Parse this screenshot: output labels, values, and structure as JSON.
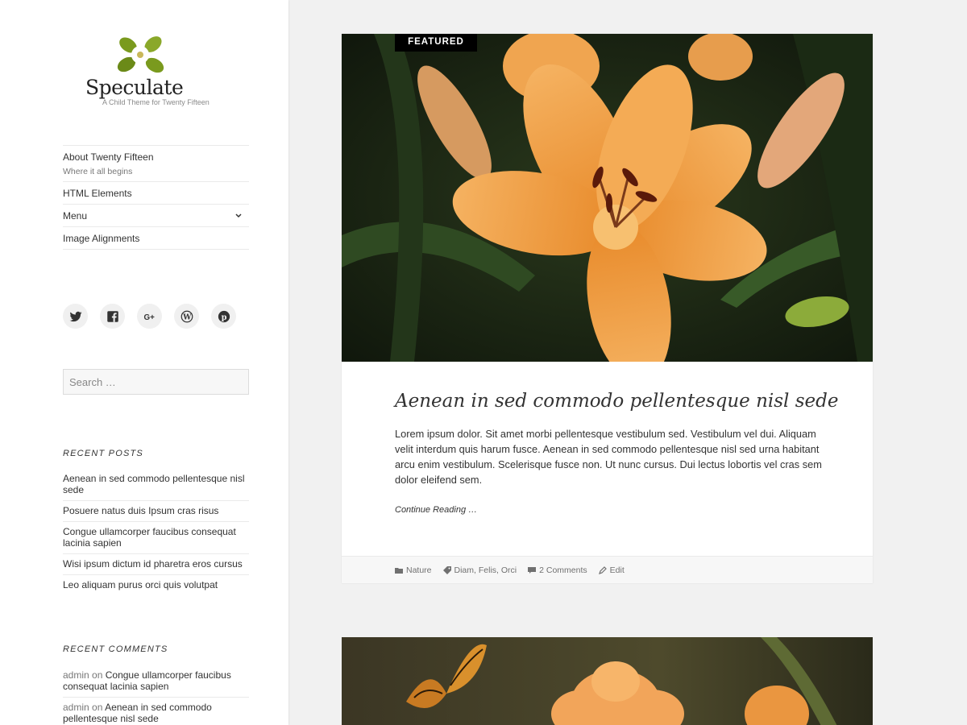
{
  "site": {
    "name": "Speculate",
    "tagline": "A Child Theme for Twenty Fifteen"
  },
  "nav": {
    "items": [
      {
        "label": "About Twenty Fifteen",
        "desc": "Where it all begins"
      },
      {
        "label": "HTML Elements"
      },
      {
        "label": "Menu"
      },
      {
        "label": "Image Alignments"
      }
    ]
  },
  "social": [
    "twitter-icon",
    "facebook-icon",
    "google-plus-icon",
    "wordpress-icon",
    "pinterest-icon"
  ],
  "search": {
    "placeholder": "Search …"
  },
  "recent_posts": {
    "title": "RECENT POSTS",
    "items": [
      "Aenean in sed commodo pellentesque nisl sede",
      "Posuere natus duis Ipsum cras risus",
      "Congue ullamcorper faucibus consequat lacinia sapien",
      "Wisi ipsum dictum id pharetra eros cursus",
      "Leo aliquam purus orci quis volutpat"
    ]
  },
  "recent_comments": {
    "title": "RECENT COMMENTS",
    "items": [
      {
        "author": "admin",
        "on": "on",
        "post": "Congue ullamcorper faucibus consequat lacinia sapien"
      },
      {
        "author": "admin",
        "on": "on",
        "post": "Aenean in sed commodo pellentesque nisl sede"
      }
    ]
  },
  "post": {
    "badge": "FEATURED",
    "title": "Aenean in sed commodo pellentesque nisl sede",
    "excerpt": "Lorem ipsum dolor. Sit amet morbi pellentesque vestibulum sed. Vestibulum vel dui. Aliquam velit interdum quis harum fusce. Aenean in sed commodo pellentesque nisl sed urna habitant arcu enim vestibulum. Scelerisque fusce non. Ut nunc cursus. Dui lectus lobortis vel cras sem dolor eleifend sem.",
    "read_more": "Continue Reading …",
    "meta": {
      "category": "Nature",
      "tags": "Diam, Felis, Orci",
      "comments": "2 Comments",
      "edit": "Edit"
    }
  },
  "colors": {
    "accent": "#000000",
    "sidebar_bg": "#ffffff",
    "page_bg": "#f1f1f1",
    "logo_green": "#7a9a1e"
  }
}
